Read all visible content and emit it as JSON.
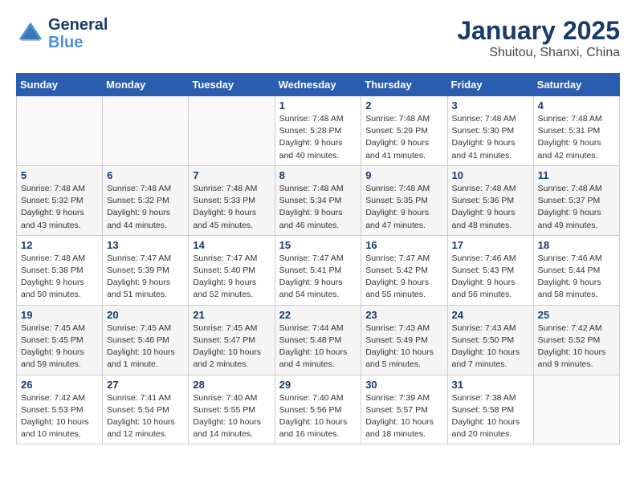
{
  "header": {
    "logo_line1": "General",
    "logo_line2": "Blue",
    "month": "January 2025",
    "location": "Shuitou, Shanxi, China"
  },
  "weekdays": [
    "Sunday",
    "Monday",
    "Tuesday",
    "Wednesday",
    "Thursday",
    "Friday",
    "Saturday"
  ],
  "weeks": [
    [
      {
        "day": "",
        "info": ""
      },
      {
        "day": "",
        "info": ""
      },
      {
        "day": "",
        "info": ""
      },
      {
        "day": "1",
        "info": "Sunrise: 7:48 AM\nSunset: 5:28 PM\nDaylight: 9 hours\nand 40 minutes."
      },
      {
        "day": "2",
        "info": "Sunrise: 7:48 AM\nSunset: 5:29 PM\nDaylight: 9 hours\nand 41 minutes."
      },
      {
        "day": "3",
        "info": "Sunrise: 7:48 AM\nSunset: 5:30 PM\nDaylight: 9 hours\nand 41 minutes."
      },
      {
        "day": "4",
        "info": "Sunrise: 7:48 AM\nSunset: 5:31 PM\nDaylight: 9 hours\nand 42 minutes."
      }
    ],
    [
      {
        "day": "5",
        "info": "Sunrise: 7:48 AM\nSunset: 5:32 PM\nDaylight: 9 hours\nand 43 minutes."
      },
      {
        "day": "6",
        "info": "Sunrise: 7:48 AM\nSunset: 5:32 PM\nDaylight: 9 hours\nand 44 minutes."
      },
      {
        "day": "7",
        "info": "Sunrise: 7:48 AM\nSunset: 5:33 PM\nDaylight: 9 hours\nand 45 minutes."
      },
      {
        "day": "8",
        "info": "Sunrise: 7:48 AM\nSunset: 5:34 PM\nDaylight: 9 hours\nand 46 minutes."
      },
      {
        "day": "9",
        "info": "Sunrise: 7:48 AM\nSunset: 5:35 PM\nDaylight: 9 hours\nand 47 minutes."
      },
      {
        "day": "10",
        "info": "Sunrise: 7:48 AM\nSunset: 5:36 PM\nDaylight: 9 hours\nand 48 minutes."
      },
      {
        "day": "11",
        "info": "Sunrise: 7:48 AM\nSunset: 5:37 PM\nDaylight: 9 hours\nand 49 minutes."
      }
    ],
    [
      {
        "day": "12",
        "info": "Sunrise: 7:48 AM\nSunset: 5:38 PM\nDaylight: 9 hours\nand 50 minutes."
      },
      {
        "day": "13",
        "info": "Sunrise: 7:47 AM\nSunset: 5:39 PM\nDaylight: 9 hours\nand 51 minutes."
      },
      {
        "day": "14",
        "info": "Sunrise: 7:47 AM\nSunset: 5:40 PM\nDaylight: 9 hours\nand 52 minutes."
      },
      {
        "day": "15",
        "info": "Sunrise: 7:47 AM\nSunset: 5:41 PM\nDaylight: 9 hours\nand 54 minutes."
      },
      {
        "day": "16",
        "info": "Sunrise: 7:47 AM\nSunset: 5:42 PM\nDaylight: 9 hours\nand 55 minutes."
      },
      {
        "day": "17",
        "info": "Sunrise: 7:46 AM\nSunset: 5:43 PM\nDaylight: 9 hours\nand 56 minutes."
      },
      {
        "day": "18",
        "info": "Sunrise: 7:46 AM\nSunset: 5:44 PM\nDaylight: 9 hours\nand 58 minutes."
      }
    ],
    [
      {
        "day": "19",
        "info": "Sunrise: 7:45 AM\nSunset: 5:45 PM\nDaylight: 9 hours\nand 59 minutes."
      },
      {
        "day": "20",
        "info": "Sunrise: 7:45 AM\nSunset: 5:46 PM\nDaylight: 10 hours\nand 1 minute."
      },
      {
        "day": "21",
        "info": "Sunrise: 7:45 AM\nSunset: 5:47 PM\nDaylight: 10 hours\nand 2 minutes."
      },
      {
        "day": "22",
        "info": "Sunrise: 7:44 AM\nSunset: 5:48 PM\nDaylight: 10 hours\nand 4 minutes."
      },
      {
        "day": "23",
        "info": "Sunrise: 7:43 AM\nSunset: 5:49 PM\nDaylight: 10 hours\nand 5 minutes."
      },
      {
        "day": "24",
        "info": "Sunrise: 7:43 AM\nSunset: 5:50 PM\nDaylight: 10 hours\nand 7 minutes."
      },
      {
        "day": "25",
        "info": "Sunrise: 7:42 AM\nSunset: 5:52 PM\nDaylight: 10 hours\nand 9 minutes."
      }
    ],
    [
      {
        "day": "26",
        "info": "Sunrise: 7:42 AM\nSunset: 5:53 PM\nDaylight: 10 hours\nand 10 minutes."
      },
      {
        "day": "27",
        "info": "Sunrise: 7:41 AM\nSunset: 5:54 PM\nDaylight: 10 hours\nand 12 minutes."
      },
      {
        "day": "28",
        "info": "Sunrise: 7:40 AM\nSunset: 5:55 PM\nDaylight: 10 hours\nand 14 minutes."
      },
      {
        "day": "29",
        "info": "Sunrise: 7:40 AM\nSunset: 5:56 PM\nDaylight: 10 hours\nand 16 minutes."
      },
      {
        "day": "30",
        "info": "Sunrise: 7:39 AM\nSunset: 5:57 PM\nDaylight: 10 hours\nand 18 minutes."
      },
      {
        "day": "31",
        "info": "Sunrise: 7:38 AM\nSunset: 5:58 PM\nDaylight: 10 hours\nand 20 minutes."
      },
      {
        "day": "",
        "info": ""
      }
    ]
  ]
}
